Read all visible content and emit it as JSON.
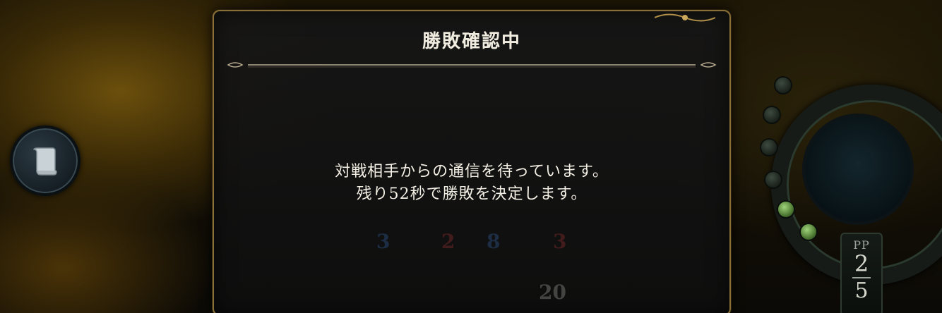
{
  "dialog": {
    "title": "勝敗確認中",
    "message_line1": "対戦相手からの通信を待っています。",
    "message_line2": "残り52秒で勝敗を決定します。"
  },
  "sidebar_left": {
    "log_button_icon": "scroll-icon"
  },
  "board": {
    "pp_label": "PP",
    "pp_current": "2",
    "pp_max": "5",
    "faded_stats": [
      "3",
      "2",
      "8",
      "3",
      "20"
    ]
  },
  "colors": {
    "dialog_border": "#8a7036",
    "dialog_bg": "#161616",
    "text": "#f3efe4",
    "board_glow": "#6b4f0c"
  }
}
